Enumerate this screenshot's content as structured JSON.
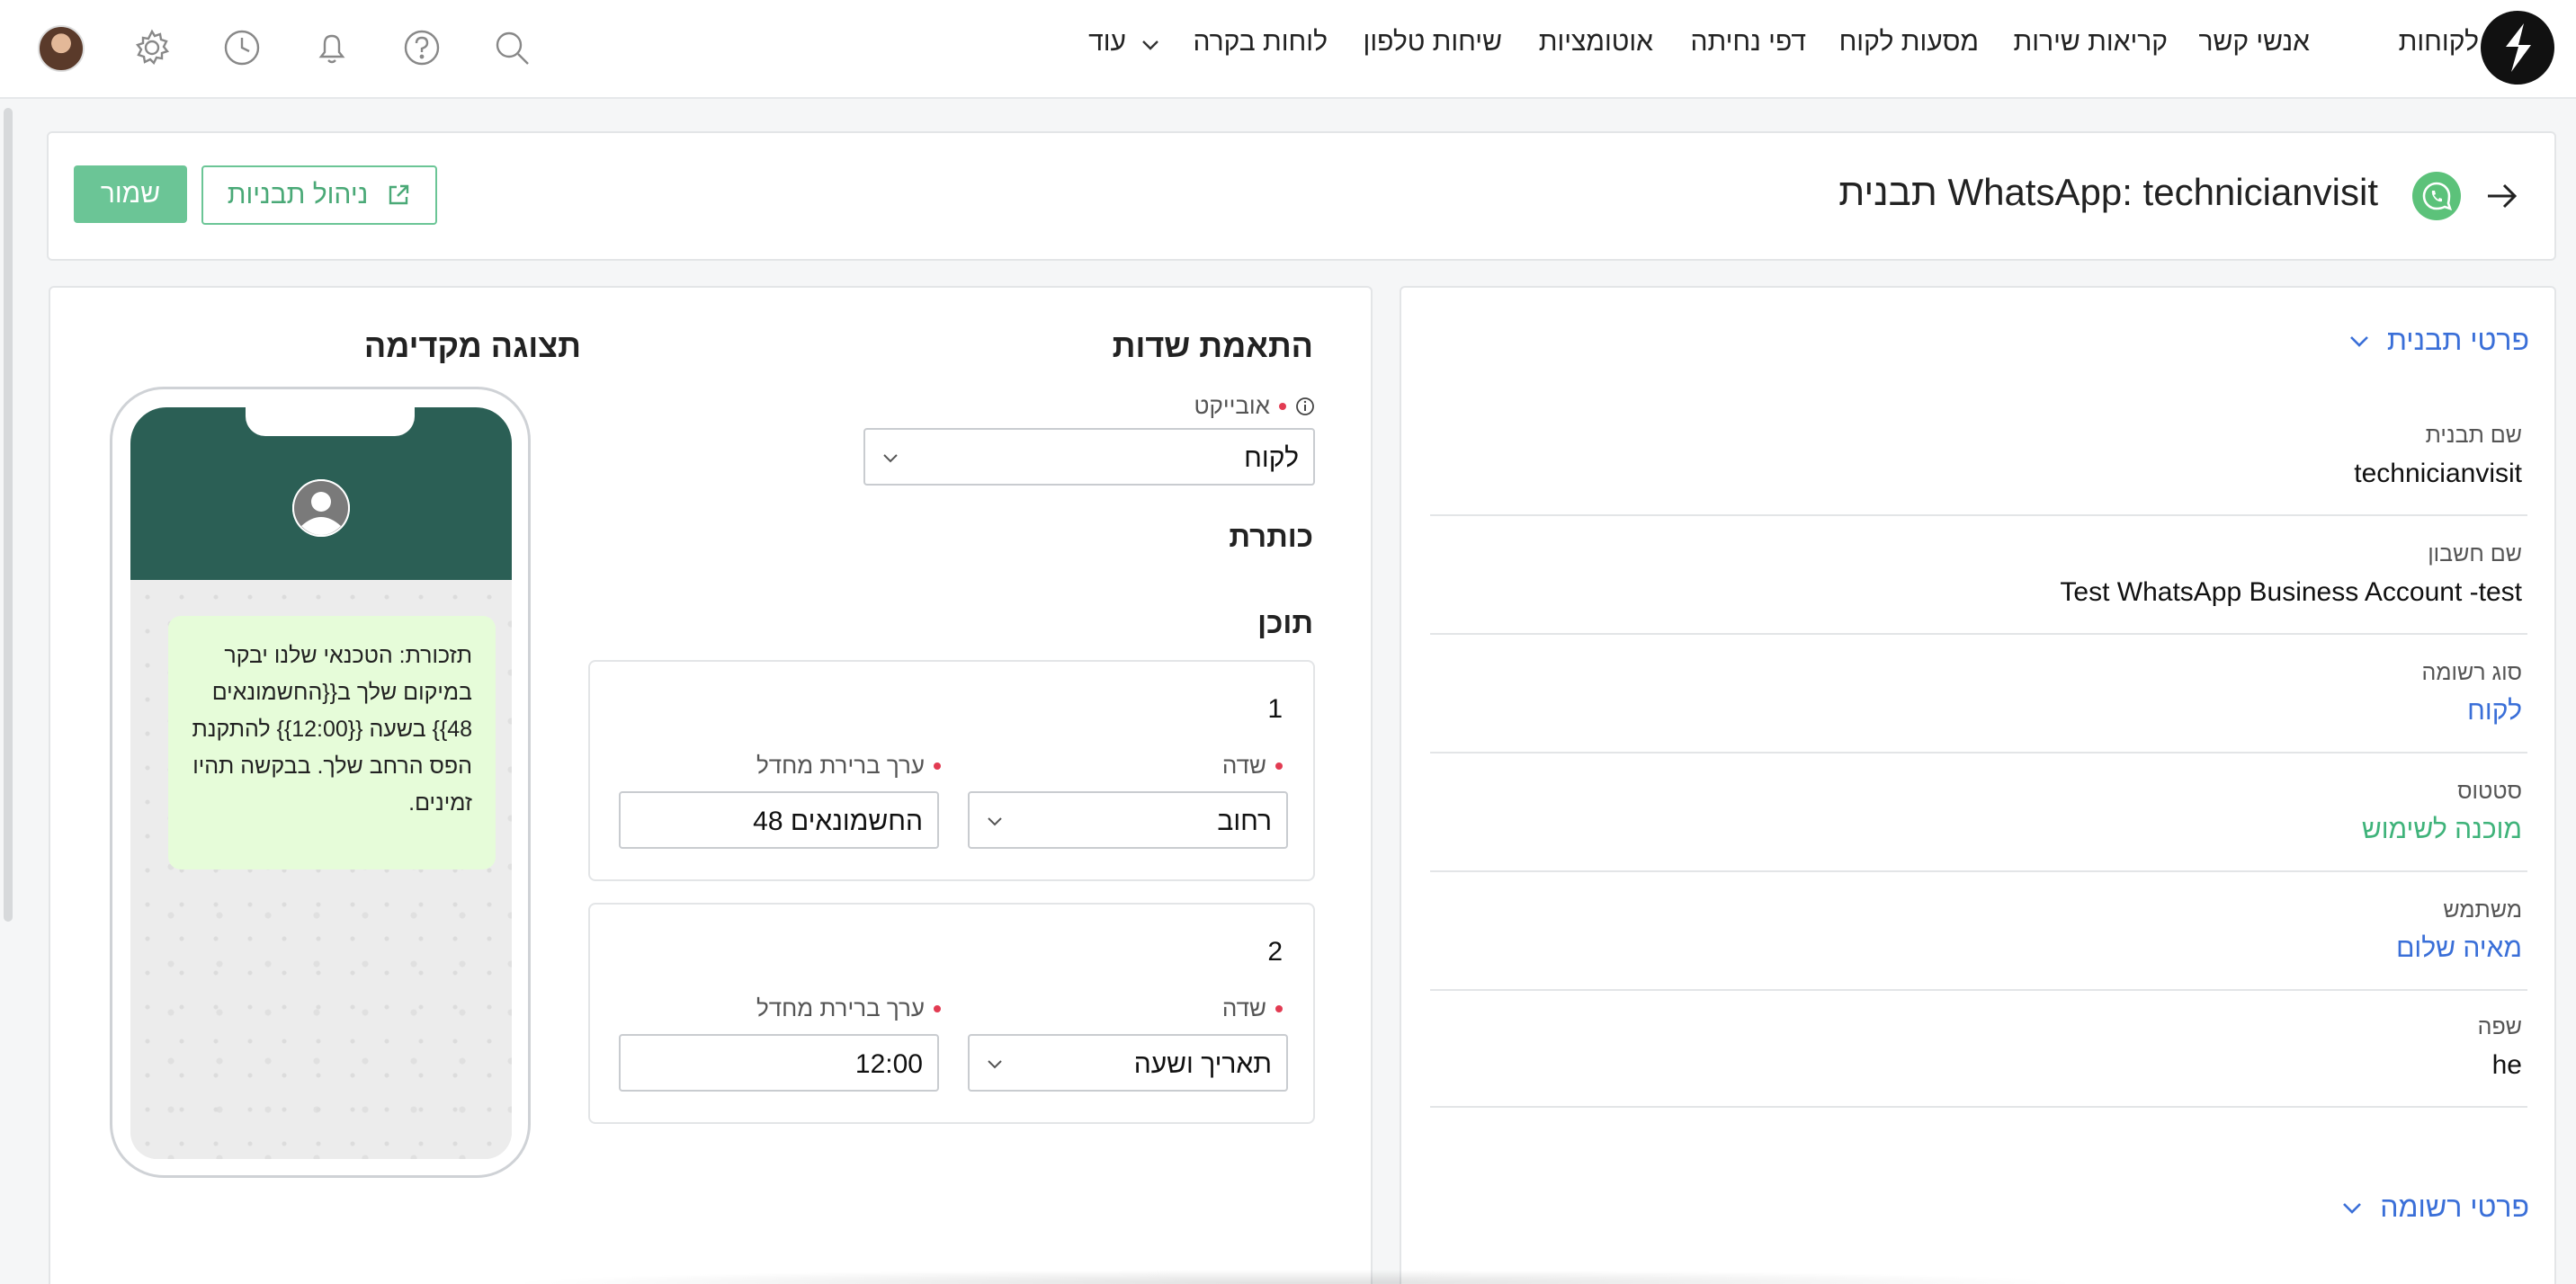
{
  "nav": {
    "items": [
      "לקוחות",
      "אנשי קשר",
      "קריאות שירות",
      "מסעות לקוח",
      "דפי נחיתה",
      "אוטומציות",
      "שיחות טלפון",
      "לוחות בקרה"
    ],
    "more_label": "עוד"
  },
  "header": {
    "title": "תבנית WhatsApp: technicianvisit",
    "manage_label": "ניהול תבניות",
    "save_label": "שמור"
  },
  "details": {
    "section_title": "פרטי תבנית",
    "fields": [
      {
        "label": "שם תבנית",
        "value": "technicianvisit"
      },
      {
        "label": "שם חשבון",
        "value": "Test WhatsApp Business Account -test"
      },
      {
        "label": "סוג רשומה",
        "value": "לקוח"
      },
      {
        "label": "סטטוס",
        "value": "מוכנה לשימוש"
      },
      {
        "label": "משתמש",
        "value": "מאיה שלום"
      },
      {
        "label": "שפה",
        "value": "he"
      }
    ],
    "record_section_title": "פרטי רשומה"
  },
  "mapping": {
    "title": "התאמת שדות",
    "object_label": "אובייקט",
    "object_value": "לקוח",
    "heading_label": "כותרת",
    "content_label": "תוכן",
    "field_label": "שדה",
    "default_label": "ערך ברירת מחדל",
    "variables": [
      {
        "number": "1",
        "field": "רחוב",
        "default": "החשמונאים 48"
      },
      {
        "number": "2",
        "field": "תאריך ושעה",
        "default": "12:00"
      }
    ]
  },
  "preview": {
    "title": "תצוגה מקדימה",
    "message": "תזכורת: הטכנאי שלנו יבקר במיקום שלך ב{{החשמונאים 48}} בשעה {{12:00}} להתקנת הפס הרחב שלך. בבקשה תהיו זמינים."
  },
  "colors": {
    "accent_green": "#6bc596",
    "link_blue": "#3a6fd8",
    "whatsapp_header": "#2b5f55",
    "bubble": "#e6fcd9",
    "required_dot": "#e23b52"
  }
}
